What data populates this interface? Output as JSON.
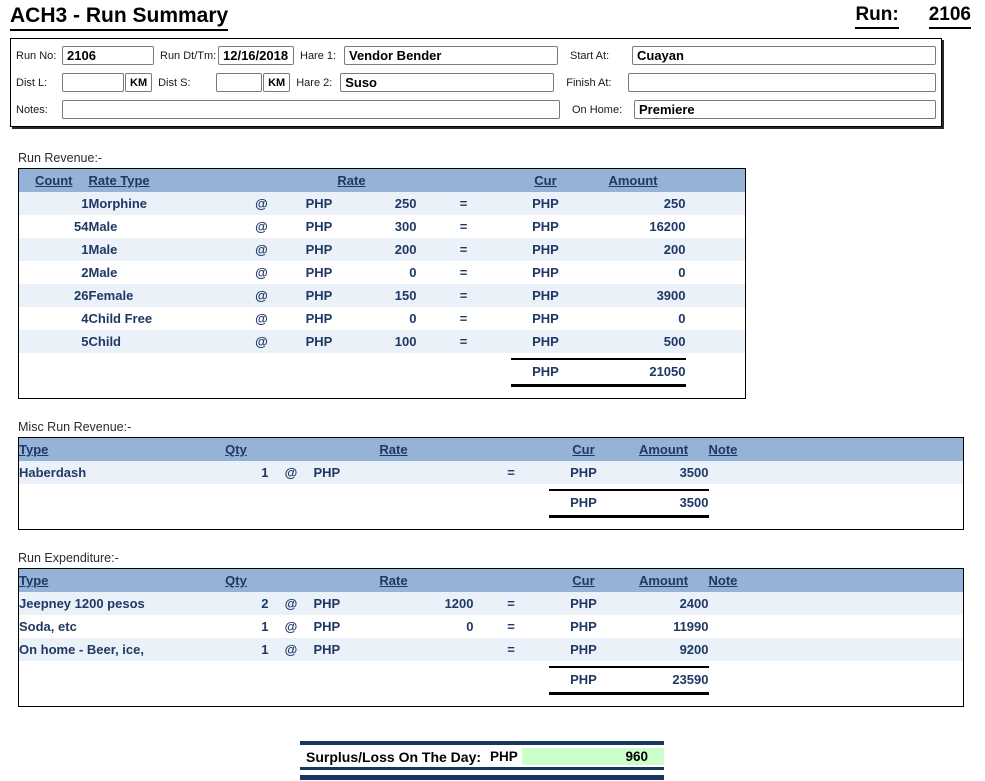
{
  "header": {
    "title": "ACH3 - Run Summary",
    "run_label": "Run:",
    "run_value": "2106"
  },
  "form": {
    "run_no": {
      "label": "Run No:",
      "value": "2106"
    },
    "run_dt": {
      "label": "Run Dt/Tm:",
      "value": "12/16/2018"
    },
    "hare1": {
      "label": "Hare 1:",
      "value": "Vendor Bender"
    },
    "start_at": {
      "label": "Start At:",
      "value": "Cuayan"
    },
    "dist_l": {
      "label": "Dist L:",
      "value": "",
      "unit": "KM"
    },
    "dist_s": {
      "label": "Dist S:",
      "value": "",
      "unit": "KM"
    },
    "hare2": {
      "label": "Hare 2:",
      "value": "Suso"
    },
    "finish_at": {
      "label": "Finish At:",
      "value": ""
    },
    "notes": {
      "label": "Notes:",
      "value": ""
    },
    "on_home": {
      "label": "On Home:",
      "value": "Premiere"
    }
  },
  "revenue": {
    "section_label": "Run Revenue:-",
    "headers": {
      "count": "Count",
      "rate_type": "Rate Type",
      "rate": "Rate",
      "cur": "Cur",
      "amount": "Amount"
    },
    "rows": [
      {
        "count": "1",
        "rate_type": "Morphine",
        "at": "@",
        "rate_cur": "PHP",
        "rate": "250",
        "eq": "=",
        "cur": "PHP",
        "amount": "250"
      },
      {
        "count": "54",
        "rate_type": "Male",
        "at": "@",
        "rate_cur": "PHP",
        "rate": "300",
        "eq": "=",
        "cur": "PHP",
        "amount": "16200"
      },
      {
        "count": "1",
        "rate_type": "Male",
        "at": "@",
        "rate_cur": "PHP",
        "rate": "200",
        "eq": "=",
        "cur": "PHP",
        "amount": "200"
      },
      {
        "count": "2",
        "rate_type": "Male",
        "at": "@",
        "rate_cur": "PHP",
        "rate": "0",
        "eq": "=",
        "cur": "PHP",
        "amount": "0"
      },
      {
        "count": "26",
        "rate_type": "Female",
        "at": "@",
        "rate_cur": "PHP",
        "rate": "150",
        "eq": "=",
        "cur": "PHP",
        "amount": "3900"
      },
      {
        "count": "4",
        "rate_type": "Child Free",
        "at": "@",
        "rate_cur": "PHP",
        "rate": "0",
        "eq": "=",
        "cur": "PHP",
        "amount": "0"
      },
      {
        "count": "5",
        "rate_type": "Child",
        "at": "@",
        "rate_cur": "PHP",
        "rate": "100",
        "eq": "=",
        "cur": "PHP",
        "amount": "500"
      }
    ],
    "total": {
      "cur": "PHP",
      "amount": "21050"
    }
  },
  "misc": {
    "section_label": "Misc Run Revenue:-",
    "headers": {
      "type": "Type",
      "qty": "Qty",
      "rate": "Rate",
      "cur": "Cur",
      "amount": "Amount",
      "note": "Note"
    },
    "rows": [
      {
        "type": "Haberdash",
        "qty": "1",
        "at": "@",
        "rate_cur": "PHP",
        "rate": "",
        "eq": "=",
        "cur": "PHP",
        "amount": "3500",
        "note": ""
      }
    ],
    "total": {
      "cur": "PHP",
      "amount": "3500"
    }
  },
  "expenditure": {
    "section_label": "Run Expenditure:-",
    "headers": {
      "type": "Type",
      "qty": "Qty",
      "rate": "Rate",
      "cur": "Cur",
      "amount": "Amount",
      "note": "Note"
    },
    "rows": [
      {
        "type": "Jeepney 1200 pesos",
        "qty": "2",
        "at": "@",
        "rate_cur": "PHP",
        "rate": "1200",
        "eq": "=",
        "cur": "PHP",
        "amount": "2400",
        "note": ""
      },
      {
        "type": "Soda, etc",
        "qty": "1",
        "at": "@",
        "rate_cur": "PHP",
        "rate": "0",
        "eq": "=",
        "cur": "PHP",
        "amount": "11990",
        "note": ""
      },
      {
        "type": "On home - Beer, ice,",
        "qty": "1",
        "at": "@",
        "rate_cur": "PHP",
        "rate": "",
        "eq": "=",
        "cur": "PHP",
        "amount": "9200",
        "note": ""
      }
    ],
    "total": {
      "cur": "PHP",
      "amount": "23590"
    }
  },
  "surplus": {
    "label": "Surplus/Loss On The Day:",
    "cur": "PHP",
    "amount": "960"
  },
  "colors": {
    "header_blue": "#95B3D7",
    "row_stripe": "#EAF1F8",
    "navy_bar": "#17375D",
    "surplus_green": "#CCFFCC"
  }
}
